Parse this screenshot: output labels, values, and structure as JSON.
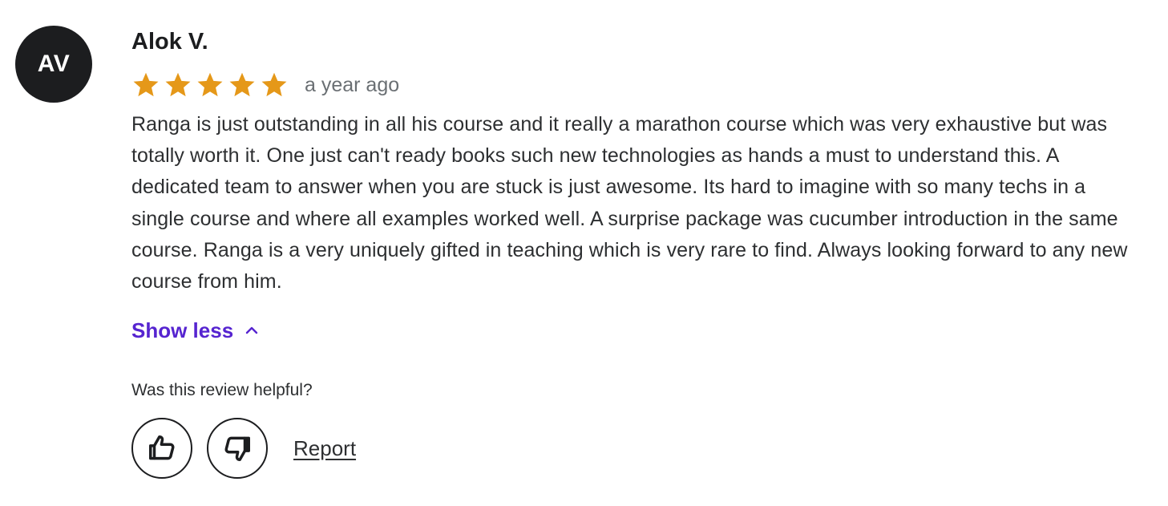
{
  "review": {
    "avatar_initials": "AV",
    "reviewer_name": "Alok V.",
    "rating": 5,
    "rating_max": 5,
    "star_color": "#e59819",
    "time_ago": "a year ago",
    "text": "Ranga is just outstanding in all his course and it really a marathon course which was very exhaustive but was totally worth it. One just can't ready books such new technologies as hands a must to understand this. A dedicated team to answer when you are stuck is just awesome. Its hard to imagine with so many techs in a single course and where all examples worked well. A surprise package was cucumber introduction in the same course. Ranga is a very uniquely gifted in teaching which is very rare to find. Always looking forward to any new course from him.",
    "toggle_label": "Show less",
    "toggle_icon": "chevron-up-icon",
    "accent_color": "#5624d0"
  },
  "feedback": {
    "question": "Was this review helpful?",
    "thumbs_up_icon": "thumbs-up-icon",
    "thumbs_down_icon": "thumbs-down-icon",
    "report_label": "Report"
  }
}
